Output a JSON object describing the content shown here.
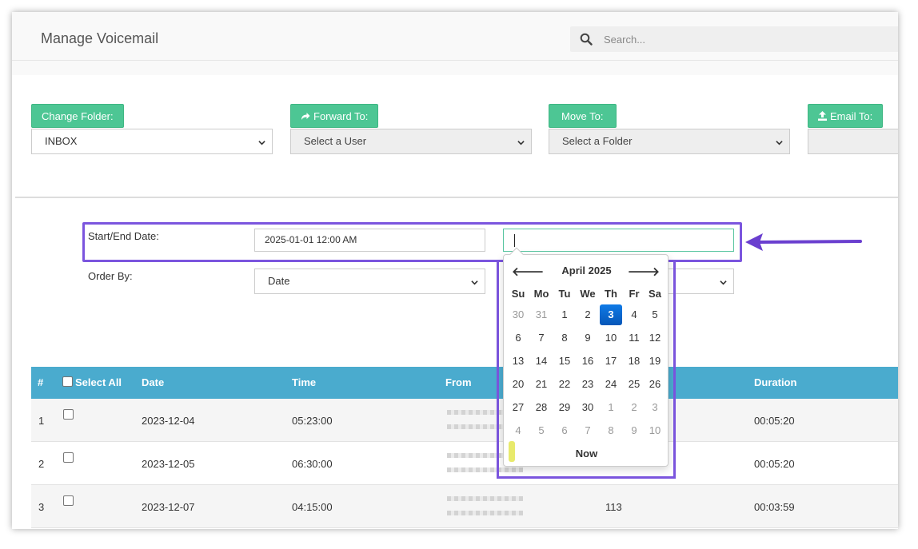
{
  "header": {
    "title": "Manage Voicemail",
    "search_placeholder": "Search..."
  },
  "actions": {
    "change_folder": {
      "label": "Change Folder:",
      "value": "INBOX"
    },
    "forward_to": {
      "label": "Forward To:",
      "value": "Select a User"
    },
    "move_to": {
      "label": "Move To:",
      "value": "Select a Folder"
    },
    "email_to": {
      "label": "Email To:",
      "value": ""
    }
  },
  "filters": {
    "date_label": "Start/End Date:",
    "start_date": "2025-01-01 12:00 AM",
    "end_date": "",
    "order_label": "Order By:",
    "order_value": "Date"
  },
  "calendar": {
    "month": "April 2025",
    "prev": "🡐",
    "next": "🡒",
    "weekdays": [
      "Su",
      "Mo",
      "Tu",
      "We",
      "Th",
      "Fr",
      "Sa"
    ],
    "weeks": [
      [
        "30",
        "31",
        "1",
        "2",
        "3",
        "4",
        "5"
      ],
      [
        "6",
        "7",
        "8",
        "9",
        "10",
        "11",
        "12"
      ],
      [
        "13",
        "14",
        "15",
        "16",
        "17",
        "18",
        "19"
      ],
      [
        "20",
        "21",
        "22",
        "23",
        "24",
        "25",
        "26"
      ],
      [
        "27",
        "28",
        "29",
        "30",
        "1",
        "2",
        "3"
      ],
      [
        "4",
        "5",
        "6",
        "7",
        "8",
        "9",
        "10"
      ]
    ],
    "selected_day": "3",
    "now_label": "Now"
  },
  "table": {
    "headers": {
      "num": "#",
      "select_all": "Select All",
      "date": "Date",
      "time": "Time",
      "from": "From",
      "duration": "Duration"
    },
    "rows": [
      {
        "num": "1",
        "date": "2023-12-04",
        "time": "05:23:00",
        "to": "",
        "duration": "00:05:20"
      },
      {
        "num": "2",
        "date": "2023-12-05",
        "time": "06:30:00",
        "to": "",
        "duration": "00:05:20"
      },
      {
        "num": "3",
        "date": "2023-12-07",
        "time": "04:15:00",
        "to": "113",
        "duration": "00:03:59"
      }
    ]
  },
  "colors": {
    "green": "#4dc694",
    "table_header": "#4aabce",
    "highlight": "#7b55de",
    "selected_day": "#0b6fd1"
  }
}
